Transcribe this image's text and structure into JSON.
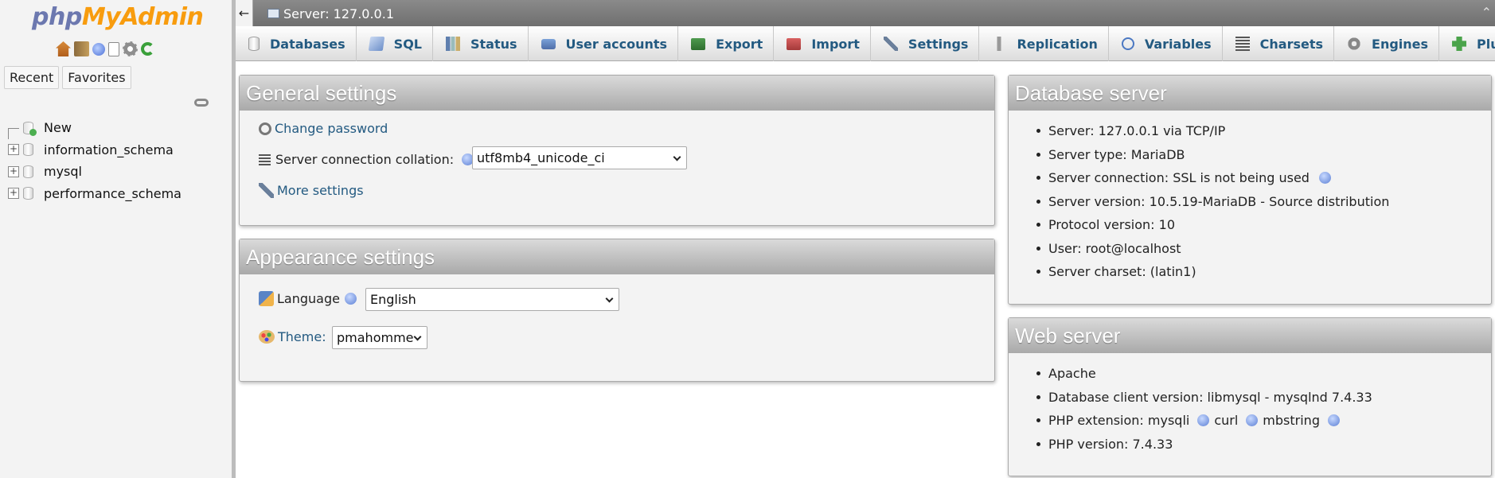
{
  "navigation": {
    "logo_php": "php",
    "logo_myadmin": "MyAdmin",
    "tabs": [
      "Recent",
      "Favorites"
    ],
    "tree": [
      {
        "label": "New",
        "type": "new"
      },
      {
        "label": "information_schema",
        "type": "db"
      },
      {
        "label": "mysql",
        "type": "db"
      },
      {
        "label": "performance_schema",
        "type": "db"
      }
    ]
  },
  "server_bar": {
    "back": "←",
    "label": "Server: 127.0.0.1"
  },
  "menu": [
    {
      "label": "Databases",
      "icon": "database-icon"
    },
    {
      "label": "SQL",
      "icon": "sql-icon"
    },
    {
      "label": "Status",
      "icon": "status-icon"
    },
    {
      "label": "User accounts",
      "icon": "users-icon"
    },
    {
      "label": "Export",
      "icon": "export-icon"
    },
    {
      "label": "Import",
      "icon": "import-icon"
    },
    {
      "label": "Settings",
      "icon": "wrench-icon"
    },
    {
      "label": "Replication",
      "icon": "replication-icon"
    },
    {
      "label": "Variables",
      "icon": "variables-icon"
    },
    {
      "label": "Charsets",
      "icon": "charsets-icon"
    },
    {
      "label": "Engines",
      "icon": "engines-icon"
    },
    {
      "label": "Plugins",
      "icon": "plugins-icon"
    }
  ],
  "general": {
    "title": "General settings",
    "change_password": "Change password",
    "collation_label": "Server connection collation:",
    "collation_value": "utf8mb4_unicode_ci",
    "more_settings": "More settings"
  },
  "appearance": {
    "title": "Appearance settings",
    "language_label": "Language",
    "language_value": "English",
    "theme_label": "Theme:",
    "theme_value": "pmahomme"
  },
  "db_server": {
    "title": "Database server",
    "items": [
      "Server: 127.0.0.1 via TCP/IP",
      "Server type: MariaDB",
      "Server connection: SSL is not being used",
      "Server version: 10.5.19-MariaDB - Source distribution",
      "Protocol version: 10",
      "User: root@localhost",
      "Server charset: (latin1)"
    ]
  },
  "web_server": {
    "title": "Web server",
    "apache": "Apache",
    "client_version": "Database client version: libmysql - mysqlnd 7.4.33",
    "php_ext_label": "PHP extension: mysqli",
    "php_ext_curl": "curl",
    "php_ext_mbstring": "mbstring",
    "php_version": "PHP version: 7.4.33"
  },
  "colors": {
    "link": "#235a81",
    "logo_php": "#6c78af",
    "logo_myadmin": "#f89c0e",
    "panel_header": "#a9a9a9"
  }
}
